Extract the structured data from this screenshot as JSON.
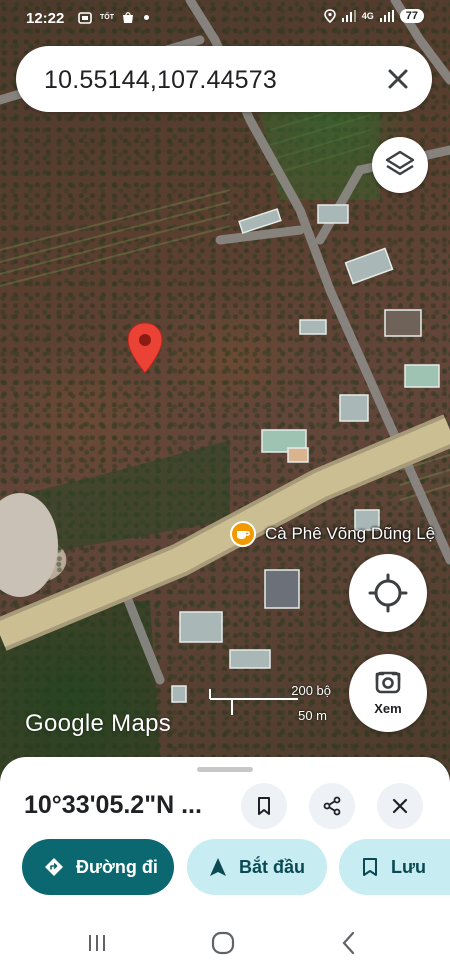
{
  "status_bar": {
    "time": "12:22",
    "left_icons": [
      "screenshot-icon",
      "tot-badge",
      "shopee-icon",
      "dot"
    ],
    "tot_label": "TỐT",
    "network": "4G",
    "battery": "77"
  },
  "search": {
    "value": "10.55144,107.44573"
  },
  "map": {
    "poi_label": "Cà Phê Võng Dũng Lệ",
    "scale_top": "200 bộ",
    "scale_bottom": "50 m",
    "logo": "Google Maps",
    "lens_label": "Xem"
  },
  "sheet": {
    "title": "10°33'05.2\"N ...",
    "buttons": {
      "directions": "Đường đi",
      "start": "Bắt đầu",
      "save": "Lưu"
    }
  },
  "colors": {
    "primary": "#0b6770",
    "tonal": "#c7ecf2",
    "pin": "#ea4335",
    "poi": "#f29900"
  }
}
